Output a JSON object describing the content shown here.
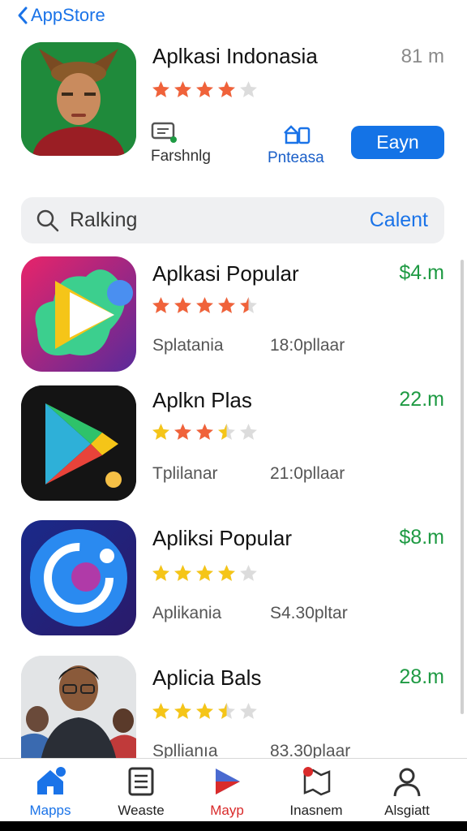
{
  "nav": {
    "back_label": "AppStore"
  },
  "featured": {
    "title": "Aplkasi Indonasia",
    "size": "81 m",
    "rating": 4,
    "meta_left_label": "Farshnlg",
    "meta_mid_label": "Pnteasa",
    "get_label": "Eayn"
  },
  "search": {
    "query": "Ralking",
    "cancel_label": "Calent"
  },
  "apps": [
    {
      "title": "Aplkasi Popular",
      "price": "$4.m",
      "rating": 4.5,
      "subtitle": "Splatania",
      "downloads": "18:0pllaar",
      "icon": "play-store-colorful-icon"
    },
    {
      "title": "Aplkn Plas",
      "price": "22.m",
      "rating": 3.5,
      "subtitle": "Tplilanar",
      "downloads": "21:0pllaar",
      "icon": "play-triangle-icon"
    },
    {
      "title": "Apliksi Popular",
      "price": "$8.m",
      "rating": 4,
      "subtitle": "Aplikania",
      "downloads": "S4.30pltar",
      "icon": "circle-logo-icon"
    },
    {
      "title": "Aplicia Bals",
      "price": "28.m",
      "rating": 3.5,
      "subtitle": "Spllianıa",
      "downloads": "83.30plaar",
      "icon": "person-photo"
    }
  ],
  "tabs": [
    {
      "label": "Mapps",
      "icon": "home-icon",
      "active": true
    },
    {
      "label": "Weaste",
      "icon": "document-icon",
      "active": false
    },
    {
      "label": "Mayp",
      "icon": "play-icon",
      "active": false
    },
    {
      "label": "Inasnem",
      "icon": "map-icon",
      "active": false
    },
    {
      "label": "Alsgiatt",
      "icon": "person-icon",
      "active": false
    }
  ],
  "colors": {
    "accent": "#1473e6",
    "price": "#1e9a43",
    "star_orange": "#f0623a",
    "star_gold": "#f5c518",
    "tab_active": "#1a73e8",
    "tab_red": "#d92b2b"
  }
}
